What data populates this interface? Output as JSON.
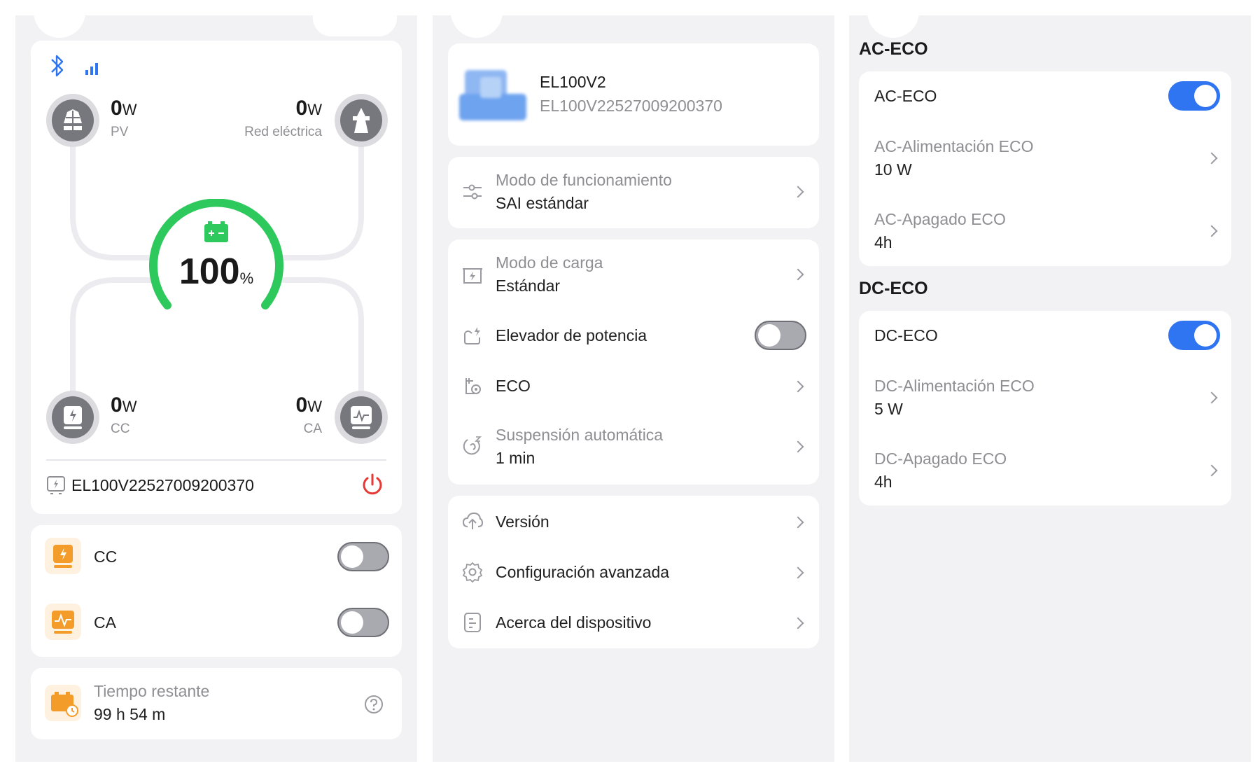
{
  "dashboard": {
    "pv": {
      "value": "0",
      "unit": "W",
      "label": "PV"
    },
    "grid": {
      "value": "0",
      "unit": "W",
      "label": "Red eléctrica"
    },
    "dc": {
      "value": "0",
      "unit": "W",
      "label": "CC"
    },
    "ac": {
      "value": "0",
      "unit": "W",
      "label": "CA"
    },
    "battery": {
      "percent": "100",
      "unit": "%",
      "level": 1.0
    },
    "serial": "EL100V22527009200370"
  },
  "outputs": [
    {
      "label": "CC",
      "on": false
    },
    {
      "label": "CA",
      "on": false
    }
  ],
  "remaining": {
    "label": "Tiempo restante",
    "value": "99 h 54 m"
  },
  "device": {
    "model": "EL100V2",
    "serial": "EL100V22527009200370"
  },
  "settings": {
    "work_mode": {
      "label": "Modo de funcionamiento",
      "value": "SAI estándar"
    },
    "charge_mode": {
      "label": "Modo de carga",
      "value": "Estándar"
    },
    "power_boost": {
      "label": "Elevador de potencia",
      "on": false
    },
    "eco": {
      "label": "ECO"
    },
    "auto_sleep": {
      "label": "Suspensión automática",
      "value": "1 min"
    },
    "version": {
      "label": "Versión"
    },
    "advanced": {
      "label": "Configuración avanzada"
    },
    "about": {
      "label": "Acerca del dispositivo"
    }
  },
  "ac_eco": {
    "section": "AC-ECO",
    "toggle_label": "AC-ECO",
    "on": true,
    "power": {
      "label": "AC-Alimentación ECO",
      "value": "10 W"
    },
    "off": {
      "label": "AC-Apagado ECO",
      "value": "4h"
    }
  },
  "dc_eco": {
    "section": "DC-ECO",
    "toggle_label": "DC-ECO",
    "on": true,
    "power": {
      "label": "DC-Alimentación ECO",
      "value": "5 W"
    },
    "off": {
      "label": "DC-Apagado ECO",
      "value": "4h"
    }
  },
  "colors": {
    "accent": "#2f74f0",
    "battery": "#2ec95c",
    "power": "#e53935",
    "orange": "#f39c2a"
  },
  "icons": [
    "bluetooth-icon",
    "signal-icon",
    "solar-panel-icon",
    "power-tower-icon",
    "dc-output-icon",
    "ac-output-icon",
    "device-icon",
    "power-button-icon",
    "help-icon",
    "sliders-icon",
    "charging-icon",
    "boost-icon",
    "eco-icon",
    "sleep-icon",
    "upload-icon",
    "gear-icon",
    "info-icon"
  ]
}
